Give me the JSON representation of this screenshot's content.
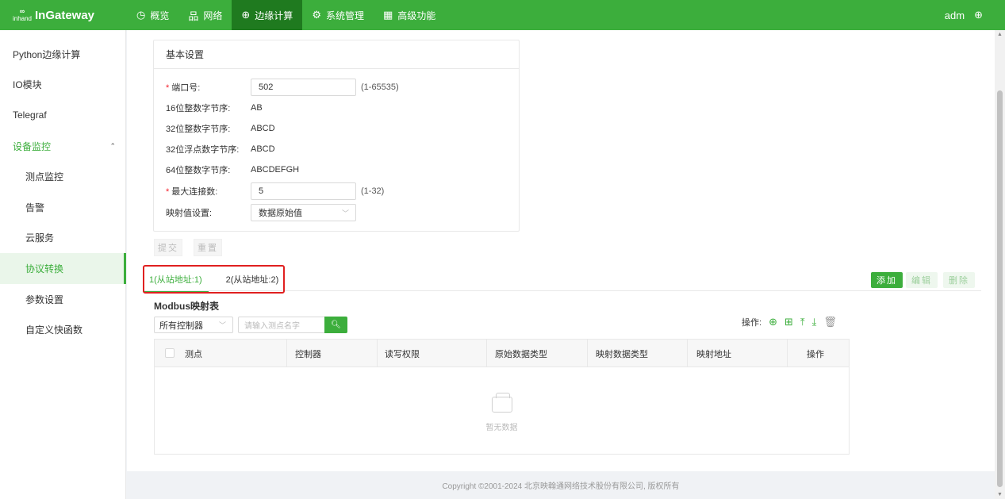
{
  "brand": {
    "sub": "inhand",
    "name": "InGateway"
  },
  "nav": [
    {
      "icon": "◷",
      "label": "概览"
    },
    {
      "icon": "品",
      "label": "网络"
    },
    {
      "icon": "⊕",
      "label": "边缘计算"
    },
    {
      "icon": "⚙",
      "label": "系统管理"
    },
    {
      "icon": "▦",
      "label": "高级功能"
    }
  ],
  "user": "adm",
  "sidebar": {
    "items": [
      "Python边缘计算",
      "IO模块",
      "Telegraf",
      "设备监控",
      "测点监控",
      "告警",
      "云服务",
      "协议转换",
      "参数设置",
      "自定义快函数"
    ],
    "caret": "⌃"
  },
  "basic": {
    "title": "基本设置",
    "port_label": "端口号:",
    "port_value": "502",
    "port_range": "(1-65535)",
    "b16_label": "16位整数字节序:",
    "b16_value": "AB",
    "b32_label": "32位整数字节序:",
    "b32_value": "ABCD",
    "f32_label": "32位浮点数字节序:",
    "f32_value": "ABCD",
    "b64_label": "64位整数字节序:",
    "b64_value": "ABCDEFGH",
    "maxconn_label": "最大连接数:",
    "maxconn_value": "5",
    "maxconn_range": "(1-32)",
    "map_label": "映射值设置:",
    "map_value": "数据原始值",
    "required_mark": "*"
  },
  "actions": {
    "submit": "提交",
    "reset": "重置"
  },
  "tabs": [
    "1(从站地址:1)",
    "2(从站地址:2)"
  ],
  "toolbar": {
    "add": "添加",
    "edit": "编辑",
    "delete": "删除"
  },
  "table": {
    "title": "Modbus映射表",
    "controller_filter": "所有控制器",
    "search_placeholder": "请输入测点名字",
    "ops_label": "操作:",
    "headers": [
      "测点",
      "控制器",
      "读写权限",
      "原始数据类型",
      "映射数据类型",
      "映射地址",
      "操作"
    ],
    "empty_text": "暂无数据"
  },
  "footer": "Copyright ©2001-2024 北京映翰通网络技术股份有限公司, 版权所有"
}
